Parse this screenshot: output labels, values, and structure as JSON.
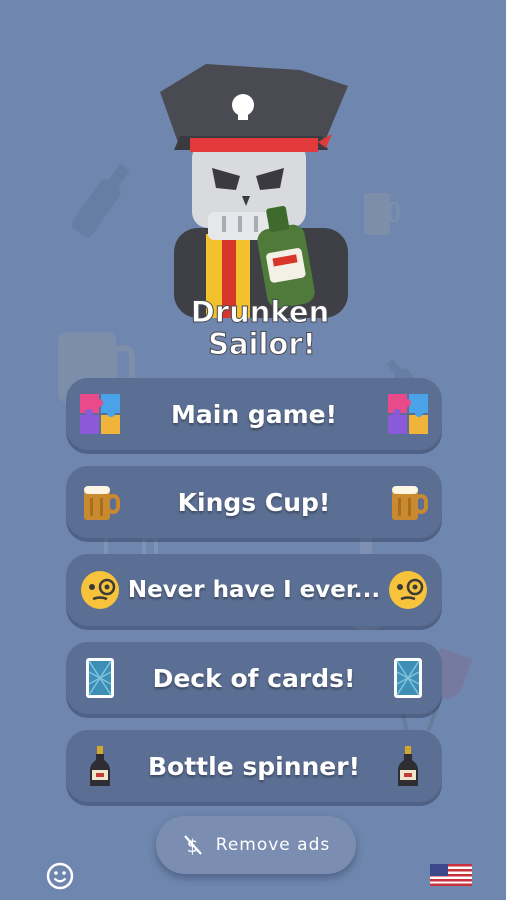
{
  "app": {
    "title_line1": "Drunken",
    "title_line2": "Sailor!"
  },
  "menu": [
    {
      "label": "Main game!",
      "icon": "puzzle-icon"
    },
    {
      "label": "Kings Cup!",
      "icon": "beer-mug-icon"
    },
    {
      "label": "Never have I ever...",
      "icon": "monocle-face-icon"
    },
    {
      "label": "Deck of cards!",
      "icon": "playing-card-icon"
    },
    {
      "label": "Bottle spinner!",
      "icon": "champagne-bottle-icon"
    }
  ],
  "remove_ads": {
    "label": "Remove ads",
    "icon": "no-money-icon"
  },
  "footer": {
    "left_icon": "smiley-icon",
    "right_icon": "us-flag-icon"
  },
  "colors": {
    "background": "#6f86ae",
    "button": "#5b6e93",
    "remove_ads_button": "#7b8eb2"
  }
}
